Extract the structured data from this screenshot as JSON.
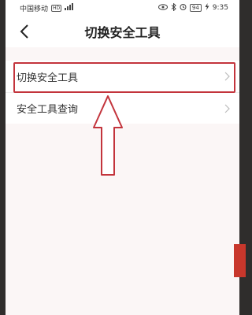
{
  "status_bar": {
    "carrier": "中国移动",
    "hd": "HD",
    "battery": "94",
    "time": "9:35"
  },
  "header": {
    "title": "切换安全工具"
  },
  "menu": {
    "items": [
      {
        "label": "切换安全工具"
      },
      {
        "label": "安全工具查询"
      }
    ]
  },
  "colors": {
    "annotation_red": "#c3343c",
    "background": "#fbf6f6"
  },
  "icons": [
    "signal-icon",
    "wifi-icon",
    "eye-icon",
    "bluetooth-icon",
    "alarm-icon",
    "back-arrow-icon",
    "chevron-right-icon",
    "up-arrow-annotation-icon"
  ]
}
